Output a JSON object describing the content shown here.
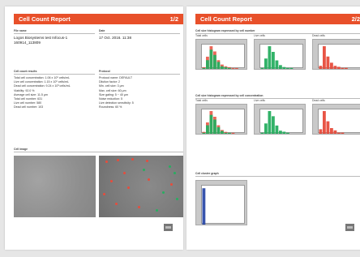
{
  "page1": {
    "banner": {
      "title": "Cell Count Report",
      "page": "1/2"
    },
    "file_name": {
      "label": "File name",
      "value_line1": "Logos Biosystems test Infocus-1",
      "value_line2": "160914_113809"
    },
    "date": {
      "label": "Date",
      "value": "17 Oct. 2016. 11:38"
    },
    "cell_count_results": {
      "label": "Cell count results",
      "lines": [
        "Total cell concentration: 1.06 x 10⁶ cells/mL",
        "Live cell concentration: 1.15 x 10⁶ cells/mL",
        "Dead cell concentration: 9.24 x 10³ cells/mL",
        "Viability: 92.0 %",
        "Average cell size: 11.5 μm",
        "Total cell number: 631",
        "Live cell number: 580",
        "Dead cell number: 103"
      ]
    },
    "protocol": {
      "label": "Protocol",
      "lines": [
        "Protocol name: DEFAULT",
        "Dilution factor: 2",
        "Min. cell size: 3 μm",
        "Max. cell size: 60 μm",
        "Size gating: 5 ~ 40 μm",
        "Noise reduction: 5",
        "Live detection sensitivity: 5",
        "Roundness: 60 %"
      ]
    },
    "cell_image": {
      "label": "Cell image"
    }
  },
  "page2": {
    "banner": {
      "title": "Cell Count Report",
      "page": "2/2"
    },
    "section_cell_number": {
      "label": "Cell size histogram expressed by cell number",
      "cols": [
        "Total cells",
        "Live cells",
        "Dead cells"
      ]
    },
    "section_concentration": {
      "label": "Cell size histogram expressed by cell concentration",
      "cols": [
        "Total cells",
        "Live cells",
        "Dead cells"
      ]
    },
    "section_cluster": {
      "label": "Cell cluster graph"
    }
  },
  "histograms": {
    "number": [
      {
        "series": [
          {
            "color": "#e74c3c",
            "values": [
              2,
              14,
              26,
              20,
              10,
              5,
              3,
              2,
              1,
              1,
              0,
              0
            ]
          },
          {
            "color": "#27ae60",
            "values": [
              1,
              10,
              22,
              16,
              8,
              3,
              2,
              1,
              0,
              0,
              0,
              0
            ]
          }
        ]
      },
      {
        "series": [
          {
            "color": "#27ae60",
            "values": [
              1,
              11,
              24,
              18,
              9,
              4,
              2,
              1,
              1,
              0,
              0,
              0
            ]
          }
        ]
      },
      {
        "series": [
          {
            "color": "#e74c3c",
            "values": [
              3,
              22,
              12,
              6,
              3,
              2,
              1,
              1,
              0,
              0,
              0,
              0
            ]
          }
        ]
      }
    ],
    "concentration": [
      {
        "series": [
          {
            "color": "#e74c3c",
            "values": [
              2,
              12,
              24,
              18,
              9,
              4,
              2,
              1,
              1,
              0,
              0,
              0
            ]
          },
          {
            "color": "#27ae60",
            "values": [
              1,
              9,
              20,
              15,
              7,
              3,
              1,
              1,
              0,
              0,
              0,
              0
            ]
          }
        ]
      },
      {
        "series": [
          {
            "color": "#27ae60",
            "values": [
              1,
              10,
              22,
              17,
              8,
              3,
              2,
              1,
              0,
              0,
              0,
              0
            ]
          }
        ]
      },
      {
        "series": [
          {
            "color": "#e74c3c",
            "values": [
              4,
              20,
              11,
              5,
              3,
              1,
              1,
              0,
              0,
              0,
              0,
              0
            ]
          }
        ]
      }
    ],
    "cluster": [
      {
        "series": [
          {
            "color": "#2c4aa8",
            "values": [
              28,
              0,
              0,
              0,
              0,
              0,
              0,
              0,
              0,
              0,
              0,
              0
            ]
          }
        ]
      }
    ]
  },
  "colors": {
    "accent": "#e8502a",
    "live": "#27ae60",
    "dead": "#e74c3c",
    "cluster": "#2c4aa8"
  }
}
